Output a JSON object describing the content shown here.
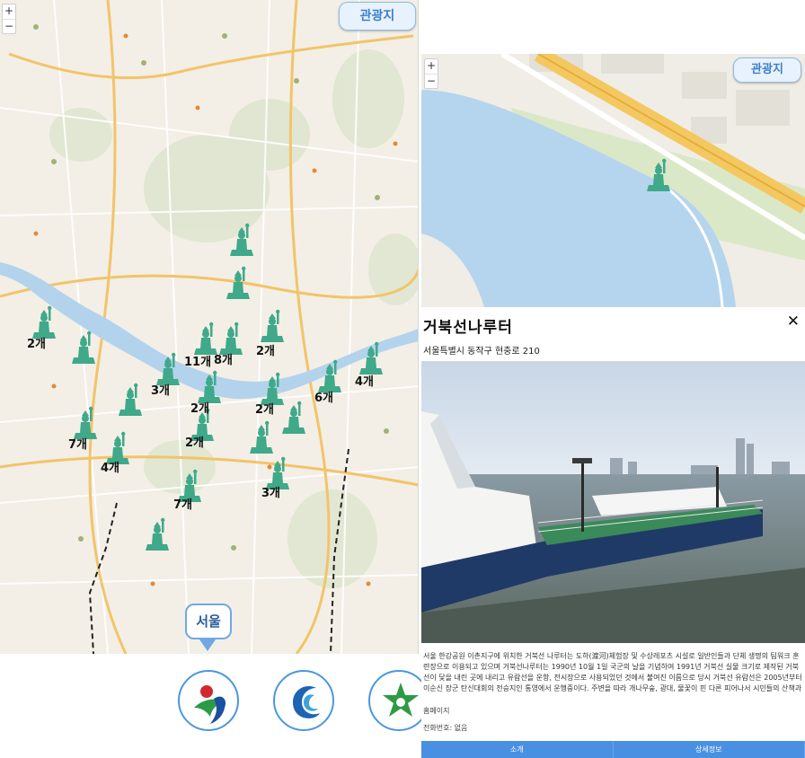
{
  "left_map": {
    "zoom_in": "+",
    "zoom_out": "−",
    "tour_button": "관광지",
    "region_label": "서울",
    "cluster_counts": [
      "2개",
      "11개",
      "8개",
      "2개",
      "3개",
      "4개",
      "2개",
      "6개",
      "2개",
      "7개",
      "2개",
      "4개",
      "3개",
      "7개"
    ]
  },
  "logos": [
    "seoul-logo-icon",
    "blue-swirl-logo-icon",
    "green-leaf-logo-icon"
  ],
  "detail": {
    "mini_map": {
      "zoom_in": "+",
      "zoom_out": "−",
      "tour_button": "관광지"
    },
    "title": "거북선나루터",
    "close": "✕",
    "address": "서울특별시 동작구 현충로 210",
    "description": "서울 한강공원 이촌지구에 위치한 거북선 나루터는 도하(渡河)체험장 및 수상레포츠 시설로 일반인들과 단체 생명의 팀워크 훈련장으로 이용되고 있으며 거북선나루터는 1990년 10월 1일 국군의 날을 기념하여 1991년 거북선 실물 크기로 제작된 거북선이 닻을 내린 곳에 내리고 유람선을 운항, 전시장으로 사용되었던 것에서 불여진 이름으로 당시 거북선 유람선은 2005년부터 이순신 장군 탄신대회의 전승지인 통영에서 운행중이다. 주변을 따라 개나무숲, 광대, 물꽃이 핀 다른 피어나서 시민들의 산책과 운동코스로 자주 이용되고 있으며 매년 10월 열리는 불꽃축제 명당지로도 유명하다. 4호선 이촌역 2-1번 출구 부나 이촌한강공원 LG한강자리 이미 있다",
    "homepage_label": "홈페이지",
    "phone_label": "전화번호: 없음",
    "tabs": [
      "소개",
      "상세정보"
    ]
  },
  "colors": {
    "accent": "#4a90e2",
    "marker": "#3fa98a",
    "river": "#b3d3ec",
    "map_bg": "#f3efe6"
  }
}
